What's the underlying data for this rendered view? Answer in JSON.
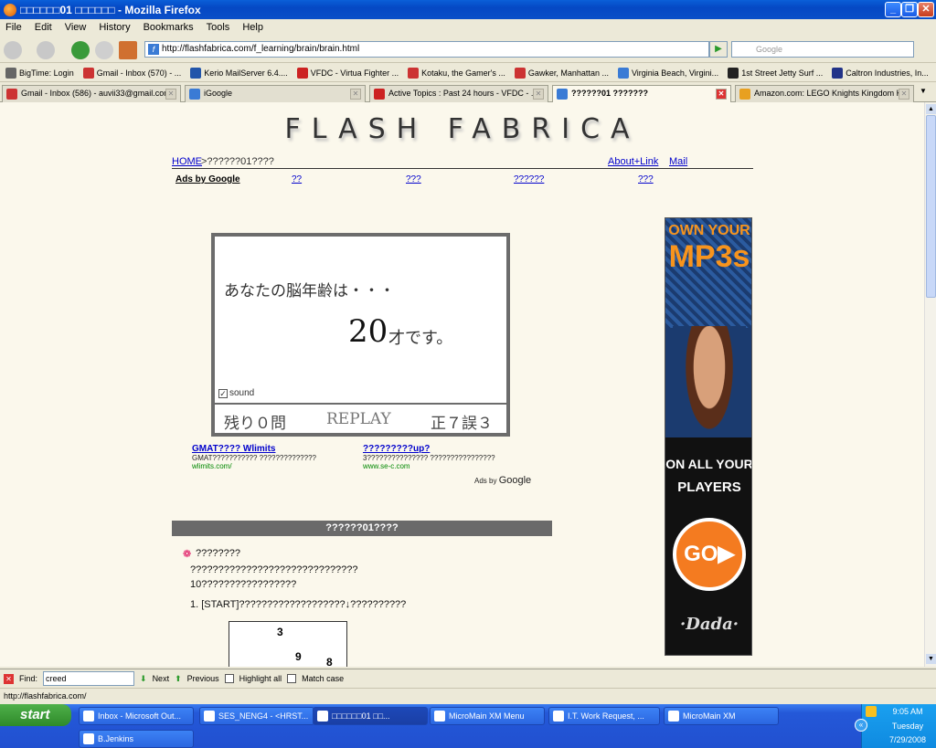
{
  "window": {
    "title": "□□□□□□01 □□□□□□ - Mozilla Firefox",
    "min": "_",
    "max": "❐",
    "close": "✕"
  },
  "menu": [
    "File",
    "Edit",
    "View",
    "History",
    "Bookmarks",
    "Tools",
    "Help"
  ],
  "nav": {
    "url": "http://flashfabrica.com/f_learning/brain/brain.html",
    "search_placeholder": "Google"
  },
  "bookmarks": [
    {
      "label": "BigTime: Login",
      "color": "#666"
    },
    {
      "label": "Gmail - Inbox (570) - ...",
      "color": "#c33"
    },
    {
      "label": "Kerio MailServer 6.4....",
      "color": "#2255aa"
    },
    {
      "label": "VFDC - Virtua Fighter ...",
      "color": "#c22"
    },
    {
      "label": "Kotaku, the Gamer's ...",
      "color": "#c33"
    },
    {
      "label": "Gawker, Manhattan ...",
      "color": "#c33"
    },
    {
      "label": "Virginia Beach, Virgini...",
      "color": "#3a7bd5"
    },
    {
      "label": "1st Street Jetty Surf ...",
      "color": "#222"
    },
    {
      "label": "Caltron Industries, In...",
      "color": "#223388"
    }
  ],
  "tabs": [
    {
      "label": "Gmail - Inbox (586) - auvii33@gmail.com",
      "color": "#c33"
    },
    {
      "label": "iGoogle",
      "color": "#3a7bd5"
    },
    {
      "label": "Active Topics : Past 24 hours - VFDC - ...",
      "color": "#c22"
    },
    {
      "label": "??????01 ???????",
      "color": "#3a7bd5"
    },
    {
      "label": "Amazon.com: LEGO Knights Kingdom K...",
      "color": "#e8a020"
    }
  ],
  "page": {
    "logo": "FLASH FABRICA",
    "home": "HOME",
    "crumb": ">??????01????",
    "about": "About+Link",
    "mail": "Mail",
    "ads_by": "Ads by Google",
    "adlinks": [
      "??",
      "???",
      "??????",
      "???"
    ],
    "quiz": {
      "line1": "あなたの脳年齢は・・・",
      "age": "20",
      "suffix": "才です。",
      "sound": "sound",
      "remaining": "残り０問",
      "replay": "REPLAY",
      "score": "正７誤３"
    },
    "ad1": {
      "title": "GMAT???? Wlimits",
      "text": "GMAT??????????? ??????????????",
      "url": "wlimits.com/"
    },
    "ad2": {
      "title": "?????????up?",
      "text": "3??????????????? ????????????????",
      "url": "www.se-c.com"
    },
    "ads_by_small": "Ads by",
    "google": "Google",
    "section_header": "??????01????",
    "intro": "????????",
    "para1": "??????????????????????????????",
    "para2": "10?????????????????",
    "step1": "1.  [START]???????????????????↓??????????",
    "grid": [
      "3",
      "9",
      "8"
    ],
    "banner": {
      "line1": "OWN YOUR",
      "line2": "MP3s",
      "line3": "ON ALL YOUR",
      "line4": "PLAYERS",
      "go": "GO▶",
      "brand": "·Dada·"
    }
  },
  "find": {
    "label": "Find:",
    "value": "creed",
    "next": "Next",
    "previous": "Previous",
    "highlight": "Highlight all",
    "match": "Match case"
  },
  "status": "http://flashfabrica.com/",
  "taskbar": {
    "start": "start",
    "items": [
      "Inbox - Microsoft Out...",
      "SES_NENG4 - <HRST...",
      "□□□□□□01 □□...",
      "MicroMain XM Menu",
      "I.T. Work Request, ...",
      "MicroMain XM",
      "B.Jenkins"
    ],
    "time": "9:05 AM",
    "day": "Tuesday",
    "date": "7/29/2008"
  }
}
